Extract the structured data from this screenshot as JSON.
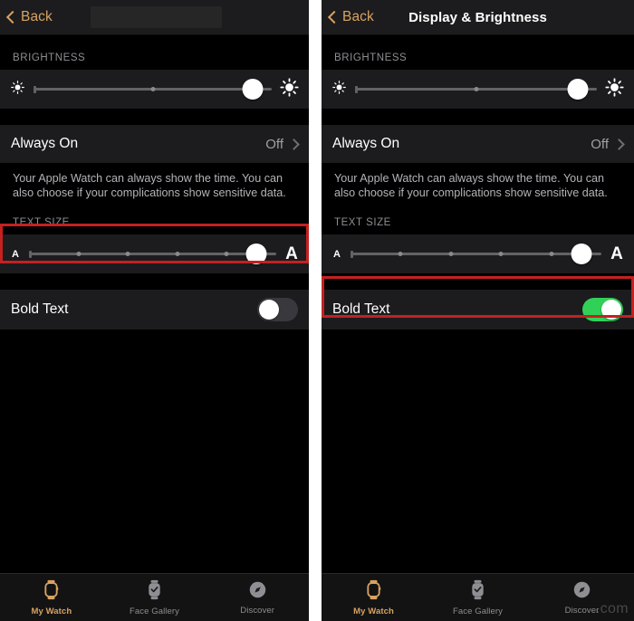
{
  "colors": {
    "background": "#000000",
    "row_background": "#1c1c1e",
    "accent_gold": "#d8a261",
    "toggle_on_green": "#31d158",
    "toggle_off_gray": "#39393d",
    "highlight_red": "#c42121",
    "section_label_gray": "#8e8e93"
  },
  "watermark": ".com",
  "panels": [
    {
      "id": "left",
      "navbar": {
        "back_label": "Back",
        "back_icon": "chevron-left-icon",
        "title": "",
        "title_redacted": true
      },
      "brightness": {
        "section_label": "BRIGHTNESS",
        "min_icon": "sun-small-icon",
        "max_icon": "sun-large-icon",
        "value_percent": 92,
        "ticks_percent": [
          50
        ]
      },
      "always_on": {
        "label": "Always On",
        "value": "Off",
        "chevron_icon": "chevron-right-icon",
        "footnote": "Your Apple Watch can always show the time. You can also choose if your complications show sensitive data."
      },
      "text_size": {
        "section_label": "TEXT SIZE",
        "min_label": "A",
        "max_label": "A",
        "value_percent": 92,
        "ticks_percent": [
          20,
          40,
          60,
          80
        ],
        "highlighted": true
      },
      "bold_text": {
        "label": "Bold Text",
        "state": "off",
        "highlighted": false
      },
      "tabs": [
        {
          "label": "My Watch",
          "icon": "watch-outline-icon",
          "active": true
        },
        {
          "label": "Face Gallery",
          "icon": "watch-face-icon",
          "active": false
        },
        {
          "label": "Discover",
          "icon": "compass-icon",
          "active": false
        }
      ]
    },
    {
      "id": "right",
      "navbar": {
        "back_label": "Back",
        "back_icon": "chevron-left-icon",
        "title": "Display & Brightness",
        "title_redacted": false
      },
      "brightness": {
        "section_label": "BRIGHTNESS",
        "min_icon": "sun-small-icon",
        "max_icon": "sun-large-icon",
        "value_percent": 92,
        "ticks_percent": [
          50
        ]
      },
      "always_on": {
        "label": "Always On",
        "value": "Off",
        "chevron_icon": "chevron-right-icon",
        "footnote": "Your Apple Watch can always show the time. You can also choose if your complications show sensitive data."
      },
      "text_size": {
        "section_label": "TEXT SIZE",
        "min_label": "A",
        "max_label": "A",
        "value_percent": 92,
        "ticks_percent": [
          20,
          40,
          60,
          80
        ],
        "highlighted": false
      },
      "bold_text": {
        "label": "Bold Text",
        "state": "on",
        "highlighted": true
      },
      "tabs": [
        {
          "label": "My Watch",
          "icon": "watch-outline-icon",
          "active": true
        },
        {
          "label": "Face Gallery",
          "icon": "watch-face-icon",
          "active": false
        },
        {
          "label": "Discover",
          "icon": "compass-icon",
          "active": false
        }
      ]
    }
  ]
}
